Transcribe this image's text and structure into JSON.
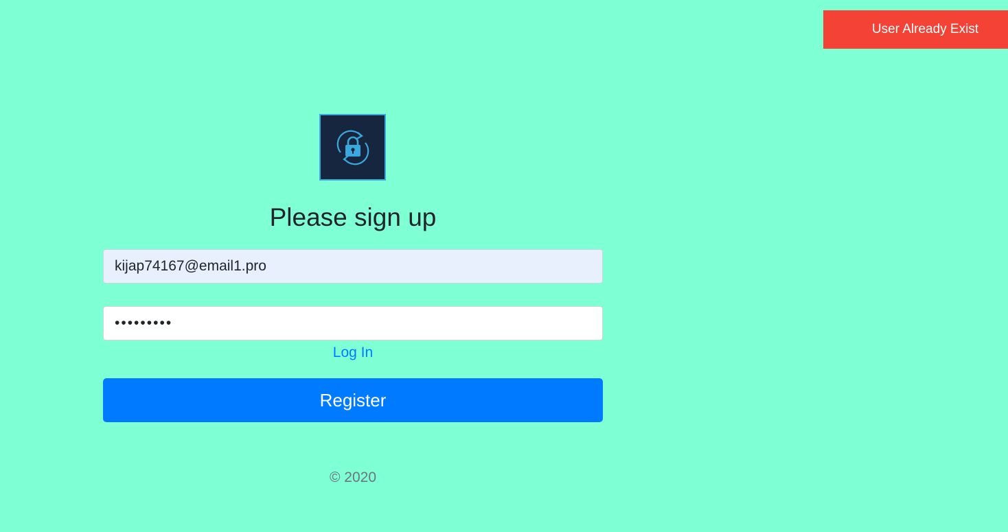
{
  "toast": {
    "message": "User Already Exist",
    "color": "#f44336"
  },
  "logo": {
    "icon": "lock-refresh-icon"
  },
  "form": {
    "heading": "Please sign up",
    "email_value": "kijap74167@email1.pro",
    "password_value": "ktyu8923p",
    "login_link": "Log In",
    "register_label": "Register",
    "accent_color": "#007bff"
  },
  "footer": {
    "copyright": "© 2020"
  },
  "background_color": "#7fffd4"
}
